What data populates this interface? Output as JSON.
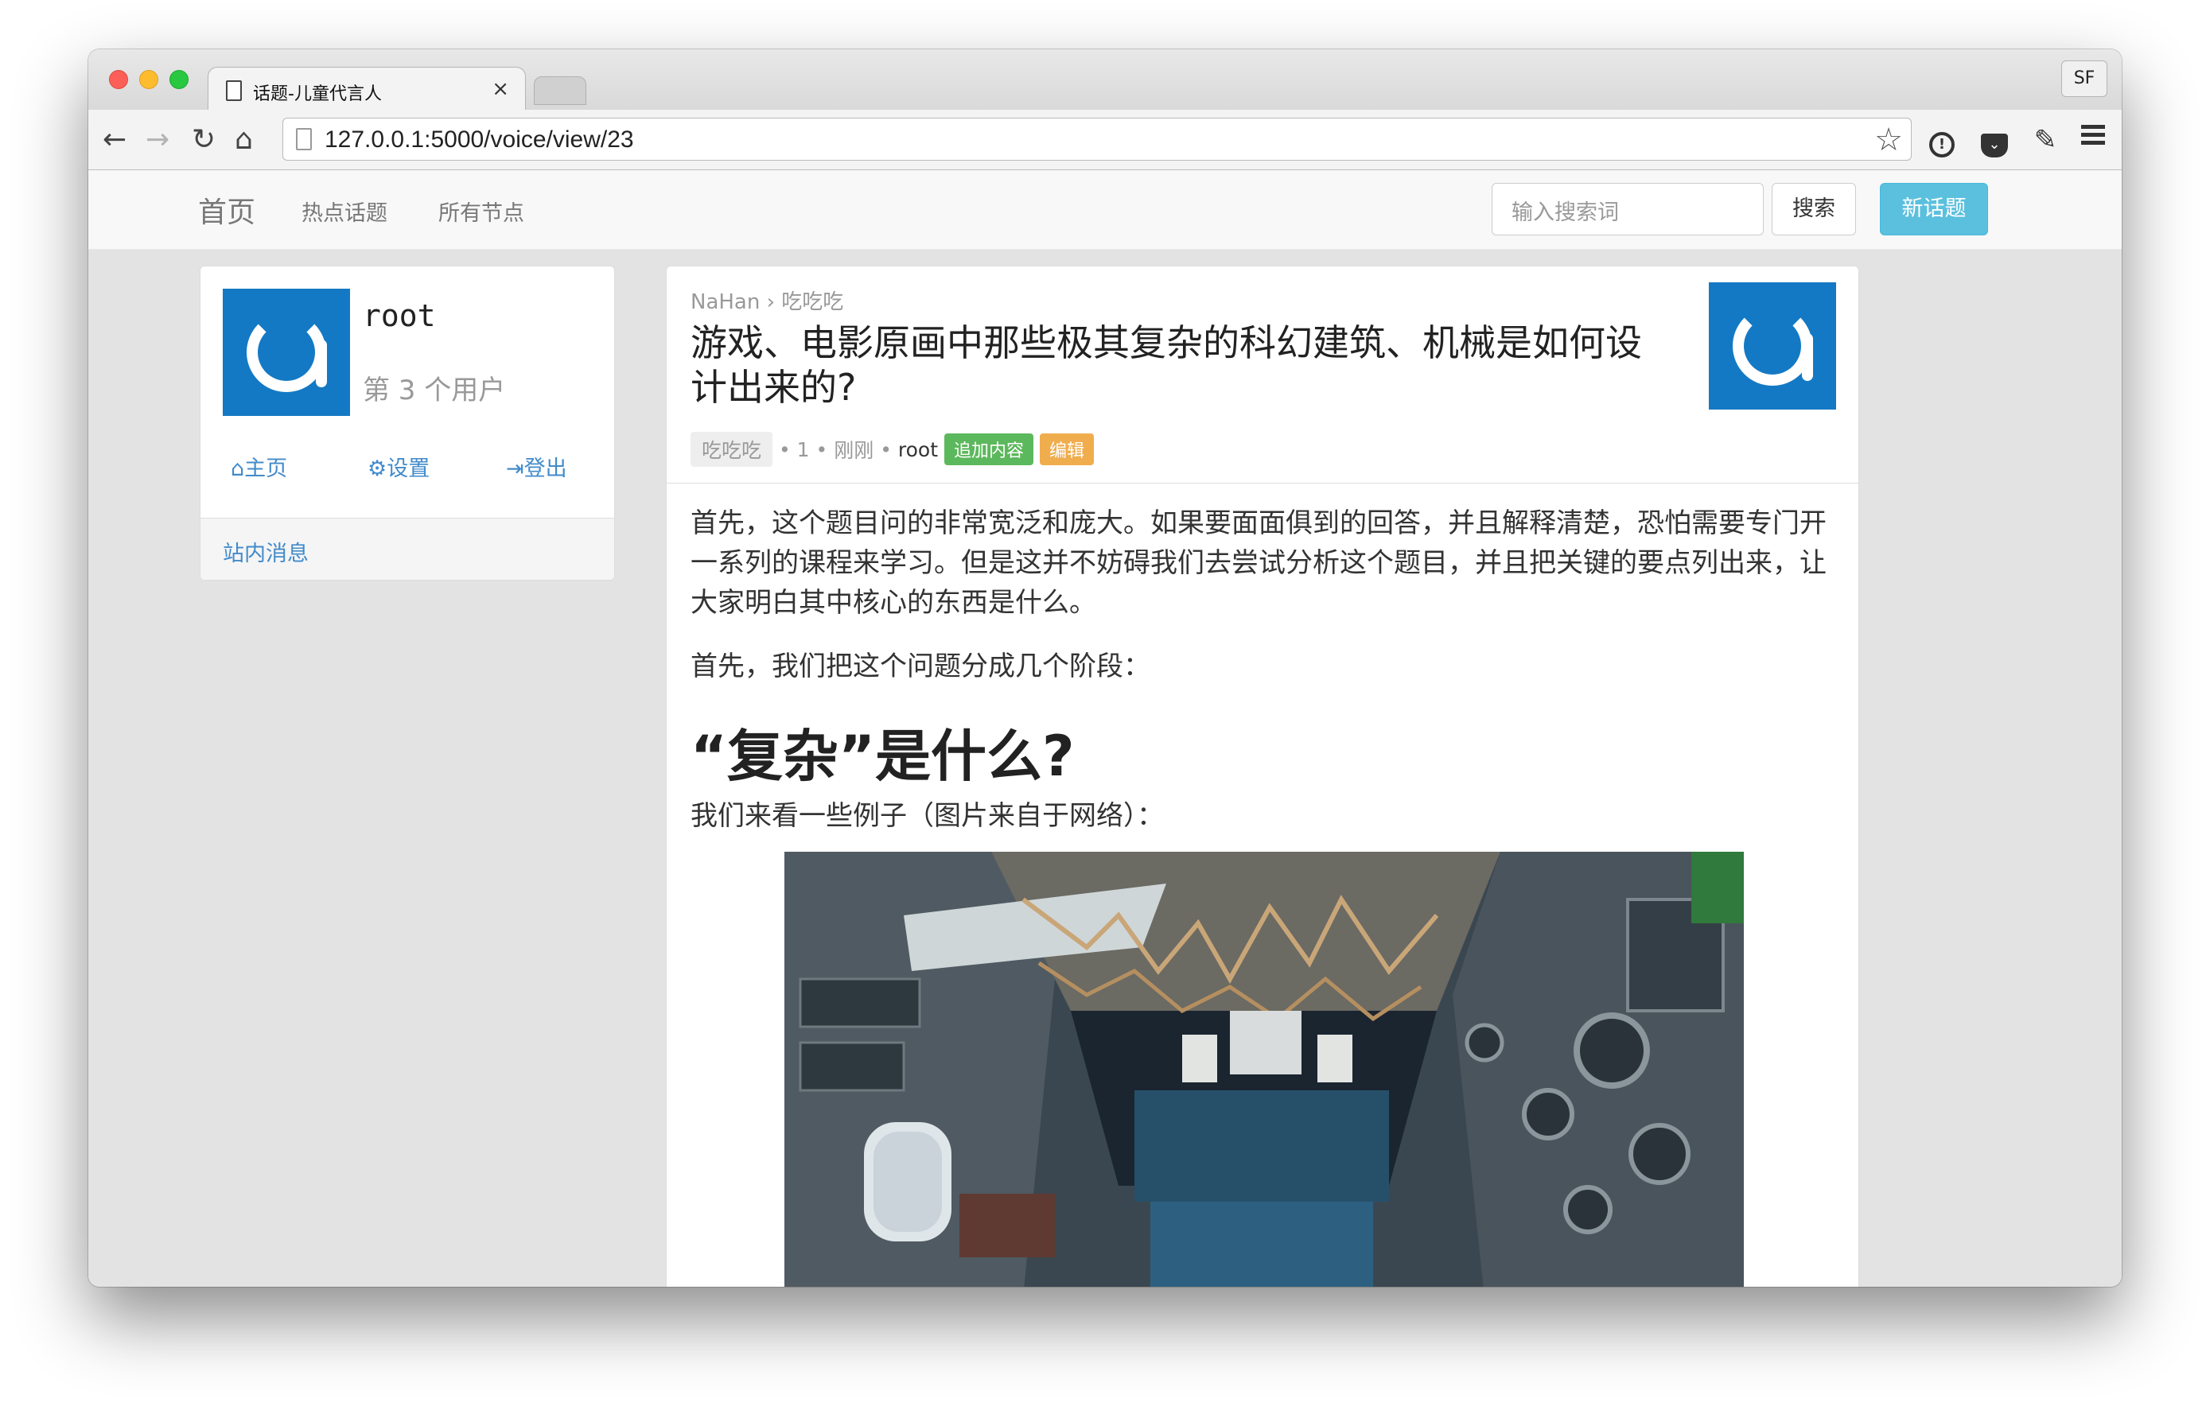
{
  "browser": {
    "tab_title": "话题-儿童代言人",
    "tab_close": "×",
    "profile": "SF",
    "url": "127.0.0.1:5000/voice/view/23"
  },
  "nav": {
    "brand": "首页",
    "hot_topics": "热点话题",
    "all_nodes": "所有节点",
    "search_placeholder": "输入搜索词",
    "search_button": "搜索",
    "new_topic": "新话题"
  },
  "sidebar": {
    "username": "root",
    "rank": "第 3 个用户",
    "home": "主页",
    "settings": "设置",
    "logout": "登出",
    "messages": "站内消息"
  },
  "topic": {
    "breadcrumb_site": "NaHan",
    "breadcrumb_sep": "›",
    "breadcrumb_node": "吃吃吃",
    "title": "游戏、电影原画中那些极其复杂的科幻建筑、机械是如何设计出来的?",
    "node": "吃吃吃",
    "count": "1",
    "time": "刚刚",
    "author": "root",
    "append_button": "追加内容",
    "edit_button": "编辑",
    "paragraph1": "首先，这个题目问的非常宽泛和庞大。如果要面面俱到的回答，并且解释清楚，恐怕需要专门开一系列的课程来学习。但是这并不妨碍我们去尝试分析这个题目，并且把关键的要点列出来，让大家明白其中核心的东西是什么。",
    "paragraph2": "首先，我们把这个问题分成几个阶段：",
    "heading": "“复杂”是什么?",
    "paragraph3": "我们来看一些例子（图片来自于网络）："
  },
  "colors": {
    "avatar_blue": "#1479c4",
    "link_blue": "#428bca",
    "label_green": "#5cb85c",
    "label_orange": "#f0ad4e",
    "new_topic_cyan": "#5bc0de"
  },
  "icons": {
    "home": "home-icon",
    "settings": "gear-icon",
    "logout": "logout-icon"
  }
}
